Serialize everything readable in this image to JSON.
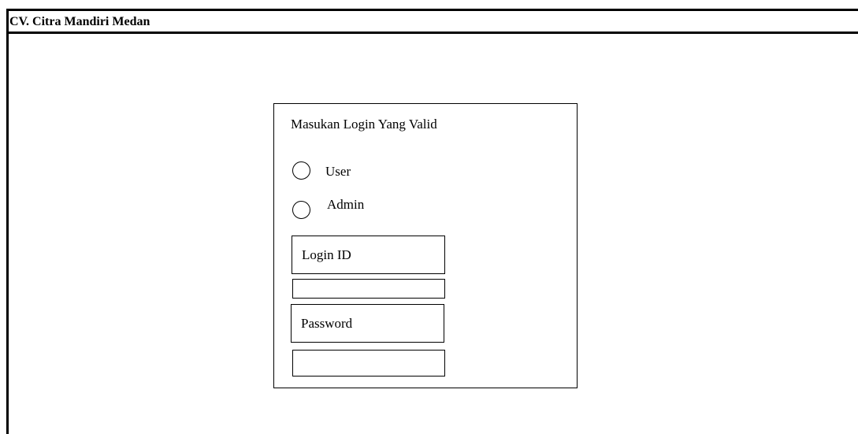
{
  "window": {
    "title": "CV. Citra Mandiri Medan"
  },
  "login": {
    "heading": "Masukan Login Yang Valid",
    "roles": [
      {
        "label": "User",
        "selected": false
      },
      {
        "label": "Admin",
        "selected": false
      }
    ],
    "login_id_label": "Login ID",
    "login_id_value": "",
    "password_label": "Password",
    "password_value": ""
  }
}
